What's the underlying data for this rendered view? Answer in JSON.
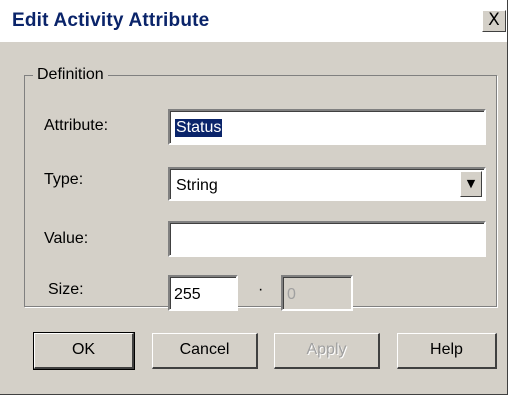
{
  "dialog": {
    "title": "Edit Activity Attribute",
    "close_glyph": "X"
  },
  "definition": {
    "group_label": "Definition",
    "attribute_label": "Attribute:",
    "attribute_value": "Status",
    "type_label": "Type:",
    "type_value": "String",
    "value_label": "Value:",
    "value_value": "",
    "size_label": "Size:",
    "size_value": "255",
    "size_separator": "·",
    "size_secondary_value": "0"
  },
  "buttons": {
    "ok": "OK",
    "cancel": "Cancel",
    "apply": "Apply",
    "help": "Help"
  },
  "icons": {
    "dropdown": "chevron-down-icon",
    "close": "close-icon"
  }
}
